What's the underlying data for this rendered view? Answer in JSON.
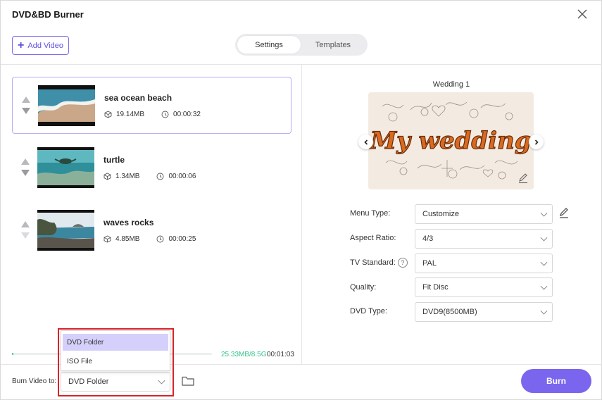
{
  "app": {
    "title": "DVD&BD Burner"
  },
  "toolbar": {
    "add_video_label": "Add Video"
  },
  "tabs": [
    {
      "label": "Settings",
      "active": true
    },
    {
      "label": "Templates",
      "active": false
    }
  ],
  "videos": [
    {
      "name": "sea ocean beach",
      "size": "19.14MB",
      "duration": "00:00:32",
      "selected": true
    },
    {
      "name": "turtle",
      "size": "1.34MB",
      "duration": "00:00:06",
      "selected": false
    },
    {
      "name": "waves rocks",
      "size": "4.85MB",
      "duration": "00:00:25",
      "selected": false
    }
  ],
  "progress": {
    "size_text": "25.33MB/8.5G",
    "fraction": 0.003,
    "total_duration": "00:01:03"
  },
  "burn": {
    "label": "Burn Video to:",
    "selected": "DVD Folder",
    "options": [
      "DVD Folder",
      "ISO File"
    ],
    "button_label": "Burn"
  },
  "template": {
    "name": "Wedding 1",
    "preview_text": "My wedding"
  },
  "settings": {
    "menu_type": {
      "label": "Menu Type:",
      "value": "Customize"
    },
    "aspect_ratio": {
      "label": "Aspect Ratio:",
      "value": "4/3"
    },
    "tv_standard": {
      "label": "TV Standard:",
      "value": "PAL"
    },
    "quality": {
      "label": "Quality:",
      "value": "Fit Disc"
    },
    "dvd_type": {
      "label": "DVD Type:",
      "value": "DVD9(8500MB)"
    }
  },
  "colors": {
    "accent": "#7a66ee",
    "highlight": "#d5d0fb",
    "progress": "#39c890",
    "annotation": "#d9222a"
  }
}
